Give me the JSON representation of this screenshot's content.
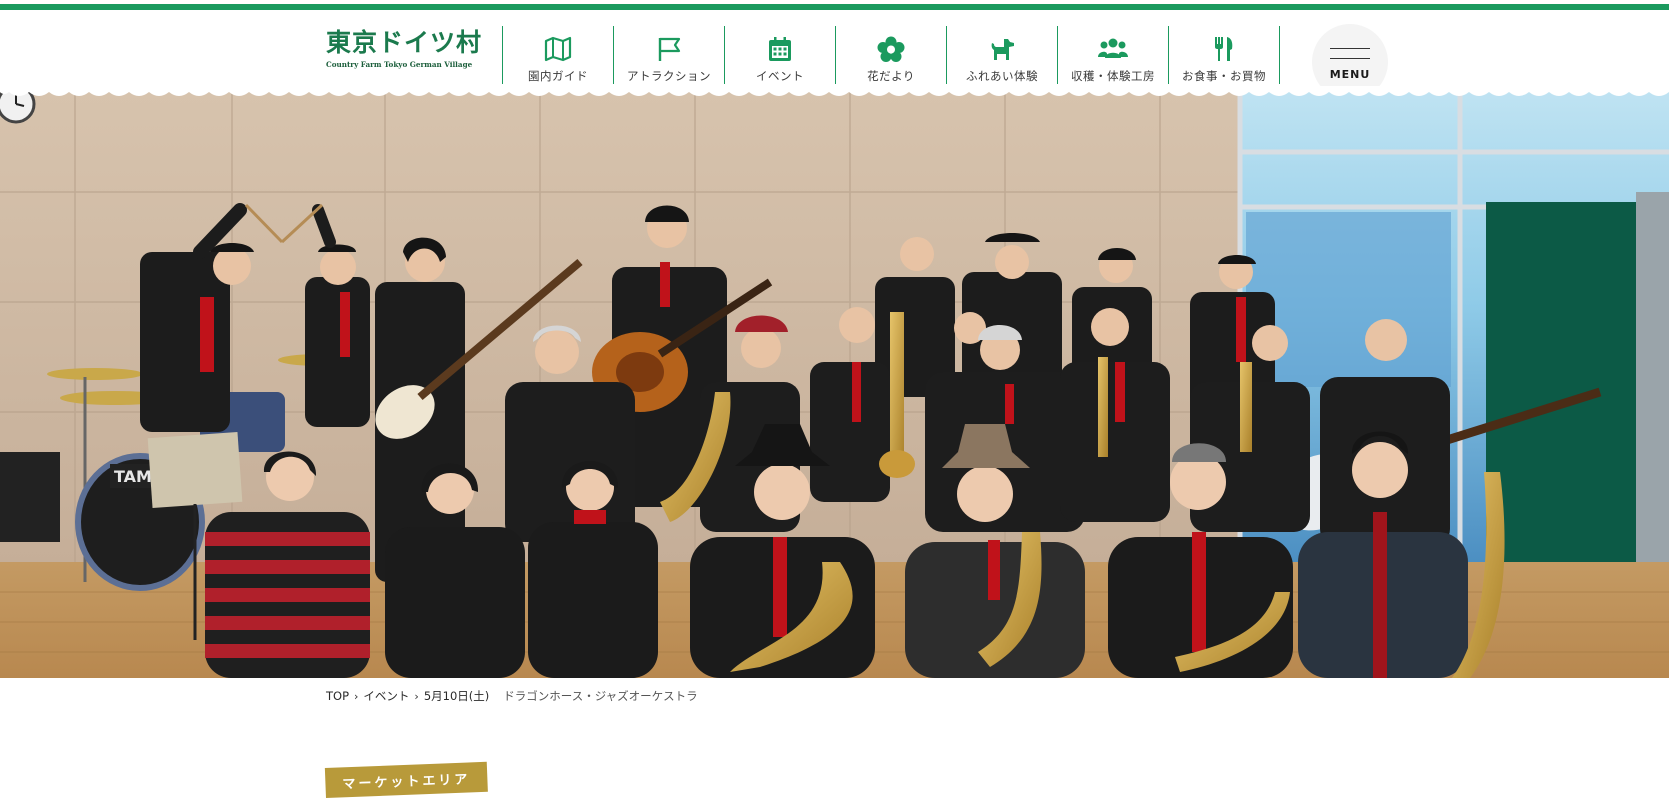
{
  "brand": {
    "logo_main": "東京ドイツ村",
    "logo_sub": "Country Farm Tokyo German Village",
    "accent_color": "#1b9a5e"
  },
  "nav": {
    "items": [
      {
        "label": "園内ガイド",
        "icon": "map-icon"
      },
      {
        "label": "アトラクション",
        "icon": "flag-icon"
      },
      {
        "label": "イベント",
        "icon": "calendar-icon"
      },
      {
        "label": "花だより",
        "icon": "flower-icon"
      },
      {
        "label": "ふれあい体験",
        "icon": "dog-icon"
      },
      {
        "label": "収穫・体験工房",
        "icon": "people-icon"
      },
      {
        "label": "お食事・お買物",
        "icon": "fork-knife-icon"
      }
    ],
    "menu_label": "MENU"
  },
  "hero": {
    "drum_brand": "TAMA"
  },
  "breadcrumb": {
    "top": "TOP",
    "events": "イベント",
    "date": "5月10日(土)",
    "current": "ドラゴンホース・ジャズオーケストラ"
  },
  "category": {
    "label": "マーケットエリア",
    "color": "#b89a3a"
  }
}
